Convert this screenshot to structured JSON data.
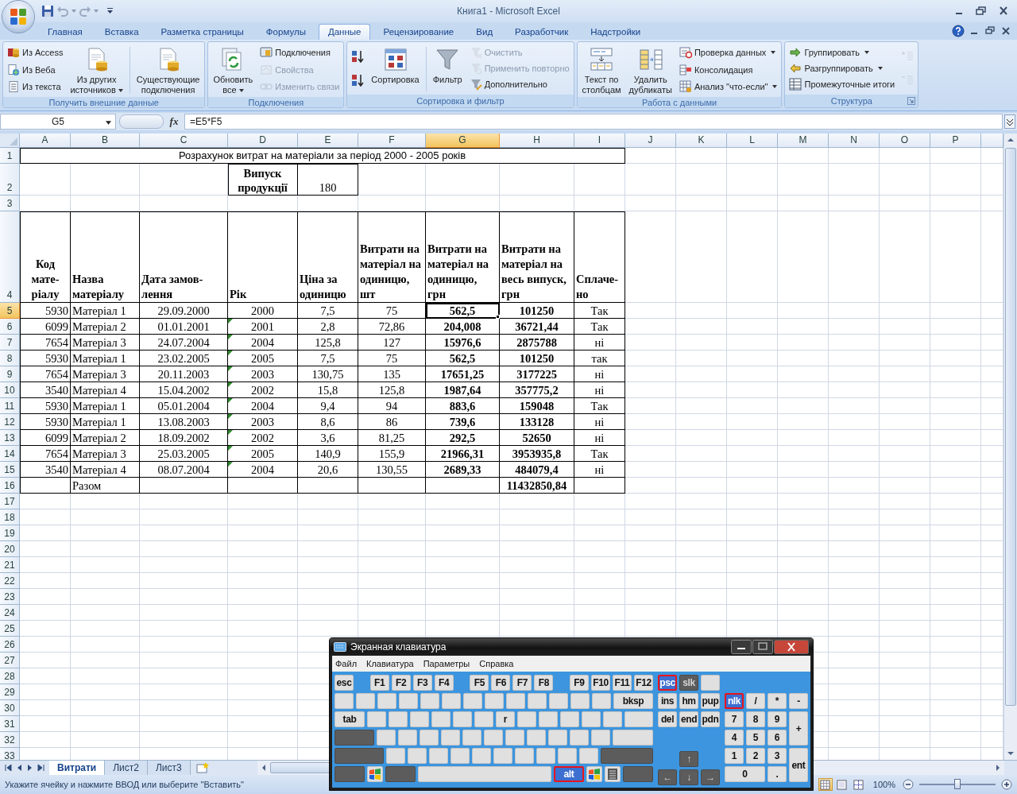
{
  "window": {
    "title": "Книга1 - Microsoft Excel"
  },
  "ribbon_tabs": [
    {
      "label": "Главная",
      "selected": false
    },
    {
      "label": "Вставка",
      "selected": false
    },
    {
      "label": "Разметка страницы",
      "selected": false
    },
    {
      "label": "Формулы",
      "selected": false
    },
    {
      "label": "Данные",
      "selected": true
    },
    {
      "label": "Рецензирование",
      "selected": false
    },
    {
      "label": "Вид",
      "selected": false
    },
    {
      "label": "Разработчик",
      "selected": false
    },
    {
      "label": "Надстройки",
      "selected": false
    }
  ],
  "ribbon_groups": [
    {
      "label": "Получить внешние данные",
      "launcher": false,
      "columns": [
        {
          "kind": "stack",
          "items": [
            {
              "label": "Из Access",
              "disabled": false,
              "dropdown": false
            },
            {
              "label": "Из Веба",
              "disabled": false,
              "dropdown": false
            },
            {
              "label": "Из текста",
              "disabled": false,
              "dropdown": false
            }
          ]
        },
        {
          "kind": "large",
          "label": "Из других\nисточников",
          "disabled": false,
          "dropdown": true
        },
        {
          "kind": "separator"
        },
        {
          "kind": "large",
          "label": "Существующие\nподключения",
          "disabled": false,
          "dropdown": false
        }
      ]
    },
    {
      "label": "Подключения",
      "launcher": false,
      "columns": [
        {
          "kind": "large",
          "label": "Обновить\nвсе",
          "disabled": false,
          "dropdown": true
        },
        {
          "kind": "stack",
          "items": [
            {
              "label": "Подключения",
              "disabled": false,
              "dropdown": false
            },
            {
              "label": "Свойства",
              "disabled": true,
              "dropdown": false
            },
            {
              "label": "Изменить связи",
              "disabled": true,
              "dropdown": false
            }
          ]
        }
      ]
    },
    {
      "label": "Сортировка и фильтр",
      "launcher": false,
      "columns": [
        {
          "kind": "stack",
          "items": [
            {
              "disabled": false,
              "dropdown": false
            },
            {
              "disabled": false,
              "dropdown": false
            }
          ]
        },
        {
          "kind": "large",
          "label": "Сортировка",
          "disabled": false,
          "dropdown": false
        },
        {
          "kind": "separator"
        },
        {
          "kind": "large",
          "label": "Фильтр",
          "disabled": false,
          "dropdown": false
        },
        {
          "kind": "stack",
          "items": [
            {
              "label": "Очистить",
              "disabled": true,
              "dropdown": false
            },
            {
              "label": "Применить повторно",
              "disabled": true,
              "dropdown": false
            },
            {
              "label": "Дополнительно",
              "disabled": false,
              "dropdown": false
            }
          ]
        }
      ]
    },
    {
      "label": "Работа с данными",
      "launcher": false,
      "columns": [
        {
          "kind": "large",
          "label": "Текст по\nстолбцам",
          "disabled": false,
          "dropdown": false
        },
        {
          "kind": "large",
          "label": "Удалить\nдубликаты",
          "disabled": false,
          "dropdown": false
        },
        {
          "kind": "stack",
          "items": [
            {
              "label": "Проверка данных",
              "disabled": false,
              "dropdown": true
            },
            {
              "label": "Консолидация",
              "disabled": false,
              "dropdown": false
            },
            {
              "label": "Анализ \"что-если\"",
              "disabled": false,
              "dropdown": true
            }
          ]
        }
      ]
    },
    {
      "label": "Структура",
      "launcher": true,
      "columns": [
        {
          "kind": "stack",
          "items": [
            {
              "label": "Группировать",
              "disabled": false,
              "dropdown": true
            },
            {
              "label": "Разгруппировать",
              "disabled": false,
              "dropdown": true
            },
            {
              "label": "Промежуточные итоги",
              "disabled": false,
              "dropdown": false
            }
          ]
        },
        {
          "kind": "stack",
          "items": [
            {
              "disabled": true,
              "dropdown": false
            },
            {
              "disabled": true,
              "dropdown": false
            }
          ]
        }
      ]
    }
  ],
  "formula_bar": {
    "name_box": "G5",
    "function_label": "fx",
    "formula": "=E5*F5"
  },
  "sheet": {
    "columns": [
      {
        "label": "A",
        "selected": false
      },
      {
        "label": "B",
        "selected": false
      },
      {
        "label": "C",
        "selected": false
      },
      {
        "label": "D",
        "selected": false
      },
      {
        "label": "E",
        "selected": false
      },
      {
        "label": "F",
        "selected": false
      },
      {
        "label": "G",
        "selected": true
      },
      {
        "label": "H",
        "selected": false
      },
      {
        "label": "I",
        "selected": false
      },
      {
        "label": "J",
        "selected": false
      },
      {
        "label": "K",
        "selected": false
      },
      {
        "label": "L",
        "selected": false
      },
      {
        "label": "M",
        "selected": false
      },
      {
        "label": "N",
        "selected": false
      },
      {
        "label": "O",
        "selected": false
      },
      {
        "label": "P",
        "selected": false
      }
    ],
    "rows": [
      {
        "number": "1",
        "selected": false,
        "kind": "title",
        "text": "Розрахунок витрат на матеріали за період 2000 - 2005 років"
      },
      {
        "number": "2",
        "selected": false,
        "kind": "output",
        "label": "Випуск\nпродукції",
        "value": "180"
      },
      {
        "number": "3",
        "selected": false,
        "kind": "empty"
      },
      {
        "number": "4",
        "selected": false,
        "kind": "header",
        "cells": [
          "Код\nмате-\nріалу",
          "Назва\nматеріалу",
          "Дата замов-\nлення",
          "Рік",
          "Ціна за\nодиницю",
          "Витрати на\nматеріал на\nодиницю,\nшт",
          "Витрати на\nматеріал на\nодиницю,\nгрн",
          "Витрати на\nматеріал на\nвесь випуск,\nгрн",
          "Сплаче-\nно"
        ]
      },
      {
        "number": "5",
        "selected": true,
        "kind": "data",
        "flag": false,
        "cells": [
          "5930",
          "Матеріал 1",
          "29.09.2000",
          "2000",
          "7,5",
          "75",
          "562,5",
          "101250",
          "Так"
        ]
      },
      {
        "number": "6",
        "selected": false,
        "kind": "data",
        "flag": true,
        "cells": [
          "6099",
          "Матеріал 2",
          "01.01.2001",
          "2001",
          "2,8",
          "72,86",
          "204,008",
          "36721,44",
          "Так"
        ]
      },
      {
        "number": "7",
        "selected": false,
        "kind": "data",
        "flag": true,
        "cells": [
          "7654",
          "Матеріал 3",
          "24.07.2004",
          "2004",
          "125,8",
          "127",
          "15976,6",
          "2875788",
          "ні"
        ]
      },
      {
        "number": "8",
        "selected": false,
        "kind": "data",
        "flag": true,
        "cells": [
          "5930",
          "Матеріал 1",
          "23.02.2005",
          "2005",
          "7,5",
          "75",
          "562,5",
          "101250",
          "так"
        ]
      },
      {
        "number": "9",
        "selected": false,
        "kind": "data",
        "flag": true,
        "cells": [
          "7654",
          "Матеріал 3",
          "20.11.2003",
          "2003",
          "130,75",
          "135",
          "17651,25",
          "3177225",
          "ні"
        ]
      },
      {
        "number": "10",
        "selected": false,
        "kind": "data",
        "flag": true,
        "cells": [
          "3540",
          "Матеріал 4",
          "15.04.2002",
          "2002",
          "15,8",
          "125,8",
          "1987,64",
          "357775,2",
          "ні"
        ]
      },
      {
        "number": "11",
        "selected": false,
        "kind": "data",
        "flag": true,
        "cells": [
          "5930",
          "Матеріал 1",
          "05.01.2004",
          "2004",
          "9,4",
          "94",
          "883,6",
          "159048",
          "Так"
        ]
      },
      {
        "number": "12",
        "selected": false,
        "kind": "data",
        "flag": true,
        "cells": [
          "5930",
          "Матеріал 1",
          "13.08.2003",
          "2003",
          "8,6",
          "86",
          "739,6",
          "133128",
          "ні"
        ]
      },
      {
        "number": "13",
        "selected": false,
        "kind": "data",
        "flag": true,
        "cells": [
          "6099",
          "Матеріал 2",
          "18.09.2002",
          "2002",
          "3,6",
          "81,25",
          "292,5",
          "52650",
          "ні"
        ]
      },
      {
        "number": "14",
        "selected": false,
        "kind": "data",
        "flag": true,
        "cells": [
          "7654",
          "Матеріал 3",
          "25.03.2005",
          "2005",
          "140,9",
          "155,9",
          "21966,31",
          "3953935,8",
          "Так"
        ]
      },
      {
        "number": "15",
        "selected": false,
        "kind": "data",
        "flag": true,
        "cells": [
          "3540",
          "Матеріал 4",
          "08.07.2004",
          "2004",
          "20,6",
          "130,55",
          "2689,33",
          "484079,4",
          "ні"
        ]
      },
      {
        "number": "16",
        "selected": false,
        "kind": "total",
        "label": "Разом",
        "value": "11432850,84"
      },
      {
        "number": "17",
        "selected": false,
        "kind": "empty"
      },
      {
        "number": "18",
        "selected": false,
        "kind": "empty"
      },
      {
        "number": "19",
        "selected": false,
        "kind": "empty"
      },
      {
        "number": "20",
        "selected": false,
        "kind": "empty"
      },
      {
        "number": "21",
        "selected": false,
        "kind": "empty"
      },
      {
        "number": "22",
        "selected": false,
        "kind": "empty"
      },
      {
        "number": "23",
        "selected": false,
        "kind": "empty"
      },
      {
        "number": "24",
        "selected": false,
        "kind": "empty"
      },
      {
        "number": "25",
        "selected": false,
        "kind": "empty"
      },
      {
        "number": "26",
        "selected": false,
        "kind": "empty"
      },
      {
        "number": "27",
        "selected": false,
        "kind": "empty"
      },
      {
        "number": "28",
        "selected": false,
        "kind": "empty"
      },
      {
        "number": "29",
        "selected": false,
        "kind": "empty"
      },
      {
        "number": "30",
        "selected": false,
        "kind": "empty"
      },
      {
        "number": "31",
        "selected": false,
        "kind": "empty"
      },
      {
        "number": "32",
        "selected": false,
        "kind": "empty"
      },
      {
        "number": "33",
        "selected": false,
        "kind": "empty"
      }
    ]
  },
  "sheet_tabs": [
    {
      "label": "Витрати",
      "selected": true
    },
    {
      "label": "Лист2",
      "selected": false
    },
    {
      "label": "Лист3",
      "selected": false
    }
  ],
  "status_bar": {
    "message": "Укажите ячейку и нажмите ВВОД или выберите \"Вставить\"",
    "views": [
      {
        "selected": true
      },
      {
        "selected": false
      },
      {
        "selected": false
      }
    ],
    "zoom": {
      "label": "100%",
      "level": 0.5
    }
  },
  "keyboard": {
    "title": "Экранная клавиатура",
    "menu": [
      "Файл",
      "Клавиатура",
      "Параметры",
      "Справка"
    ],
    "function_groups": [
      [
        {
          "label": "esc",
          "kind": "light"
        }
      ],
      [
        {
          "label": "F1",
          "kind": "light"
        },
        {
          "label": "F2",
          "kind": "light"
        },
        {
          "label": "F3",
          "kind": "light"
        },
        {
          "label": "F4",
          "kind": "light"
        }
      ],
      [
        {
          "label": "F5",
          "kind": "light"
        },
        {
          "label": "F6",
          "kind": "light"
        },
        {
          "label": "F7",
          "kind": "light"
        },
        {
          "label": "F8",
          "kind": "light"
        }
      ],
      [
        {
          "label": "F9",
          "kind": "light"
        },
        {
          "label": "F10",
          "kind": "light"
        },
        {
          "label": "F11",
          "kind": "light"
        },
        {
          "label": "F12",
          "kind": "light"
        }
      ]
    ],
    "main_rows": [
      [
        {
          "kind": "light"
        },
        {
          "kind": "light"
        },
        {
          "kind": "light"
        },
        {
          "kind": "light"
        },
        {
          "kind": "light"
        },
        {
          "kind": "light"
        },
        {
          "kind": "light"
        },
        {
          "kind": "light"
        },
        {
          "kind": "light"
        },
        {
          "kind": "light"
        },
        {
          "kind": "light"
        },
        {
          "kind": "light"
        },
        {
          "kind": "light"
        },
        {
          "label": "bksp",
          "kind": "light"
        }
      ],
      [
        {
          "label": "tab",
          "kind": "light"
        },
        {
          "kind": "light"
        },
        {
          "kind": "light"
        },
        {
          "kind": "light"
        },
        {
          "kind": "light"
        },
        {
          "kind": "light"
        },
        {
          "kind": "light"
        },
        {
          "label": "r",
          "kind": "light"
        },
        {
          "kind": "light"
        },
        {
          "kind": "light"
        },
        {
          "kind": "light"
        },
        {
          "kind": "light"
        },
        {
          "kind": "light"
        },
        {
          "kind": "light"
        }
      ],
      [
        {
          "kind": "dark"
        },
        {
          "kind": "light"
        },
        {
          "kind": "light"
        },
        {
          "kind": "light"
        },
        {
          "kind": "light"
        },
        {
          "kind": "light"
        },
        {
          "kind": "light"
        },
        {
          "kind": "light"
        },
        {
          "kind": "light"
        },
        {
          "kind": "light"
        },
        {
          "kind": "light"
        },
        {
          "kind": "light"
        },
        {
          "kind": "light"
        }
      ],
      [
        {
          "kind": "dark"
        },
        {
          "kind": "light"
        },
        {
          "kind": "light"
        },
        {
          "kind": "light"
        },
        {
          "kind": "light"
        },
        {
          "kind": "light"
        },
        {
          "kind": "light"
        },
        {
          "kind": "light"
        },
        {
          "kind": "light"
        },
        {
          "kind": "light"
        },
        {
          "kind": "light"
        },
        {
          "kind": "dark"
        }
      ],
      [
        {
          "kind": "dark"
        },
        {
          "kind": "windows"
        },
        {
          "kind": "dark"
        },
        {
          "kind": "light"
        },
        {
          "label": "alt",
          "kind": "pressed"
        },
        {
          "kind": "windows"
        },
        {
          "kind": "menu"
        },
        {
          "kind": "dark"
        }
      ]
    ],
    "nav_rows": [
      [
        {
          "label": "psc",
          "kind": "pressed"
        },
        {
          "label": "slk",
          "kind": "dark"
        },
        {
          "kind": "light"
        }
      ],
      [
        {
          "label": "ins",
          "kind": "light"
        },
        {
          "label": "hm",
          "kind": "light"
        },
        {
          "label": "pup",
          "kind": "light"
        }
      ],
      [
        {
          "label": "del",
          "kind": "light"
        },
        {
          "label": "end",
          "kind": "light"
        },
        {
          "label": "pdn",
          "kind": "light"
        }
      ]
    ],
    "arrow_up": {
      "label": "↑",
      "kind": "dark"
    },
    "arrow_row": [
      {
        "label": "←",
        "kind": "dark"
      },
      {
        "label": "↓",
        "kind": "dark"
      },
      {
        "label": "→",
        "kind": "dark"
      }
    ],
    "numpad": [
      {
        "label": "nlk",
        "kind": "pressed"
      },
      {
        "label": "/",
        "kind": "light"
      },
      {
        "label": "*",
        "kind": "light"
      },
      {
        "label": "-",
        "kind": "light"
      },
      {
        "label": "7",
        "kind": "light"
      },
      {
        "label": "8",
        "kind": "light"
      },
      {
        "label": "9",
        "kind": "light"
      },
      {
        "label": "+",
        "kind": "light"
      },
      {
        "label": "4",
        "kind": "light"
      },
      {
        "label": "5",
        "kind": "light"
      },
      {
        "label": "6",
        "kind": "light"
      },
      {
        "label": "1",
        "kind": "light"
      },
      {
        "label": "2",
        "kind": "light"
      },
      {
        "label": "3",
        "kind": "light"
      },
      {
        "label": "ent",
        "kind": "light"
      },
      {
        "label": "0",
        "kind": "light"
      },
      {
        "label": ".",
        "kind": "light"
      }
    ]
  }
}
